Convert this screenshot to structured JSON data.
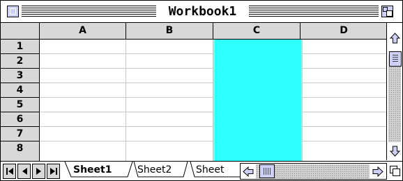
{
  "window": {
    "title": "Workbook1"
  },
  "grid": {
    "columns": [
      "A",
      "B",
      "C",
      "D"
    ],
    "rows": [
      "1",
      "2",
      "3",
      "4",
      "5",
      "6",
      "7",
      "8"
    ],
    "selected_column": "C",
    "selection_color": "#2effff"
  },
  "sheets": {
    "tabs": [
      "Sheet1",
      "Sheet2",
      "Sheet"
    ],
    "active": "Sheet1"
  },
  "nav_buttons": [
    "first-sheet",
    "previous-sheet",
    "next-sheet",
    "last-sheet"
  ]
}
